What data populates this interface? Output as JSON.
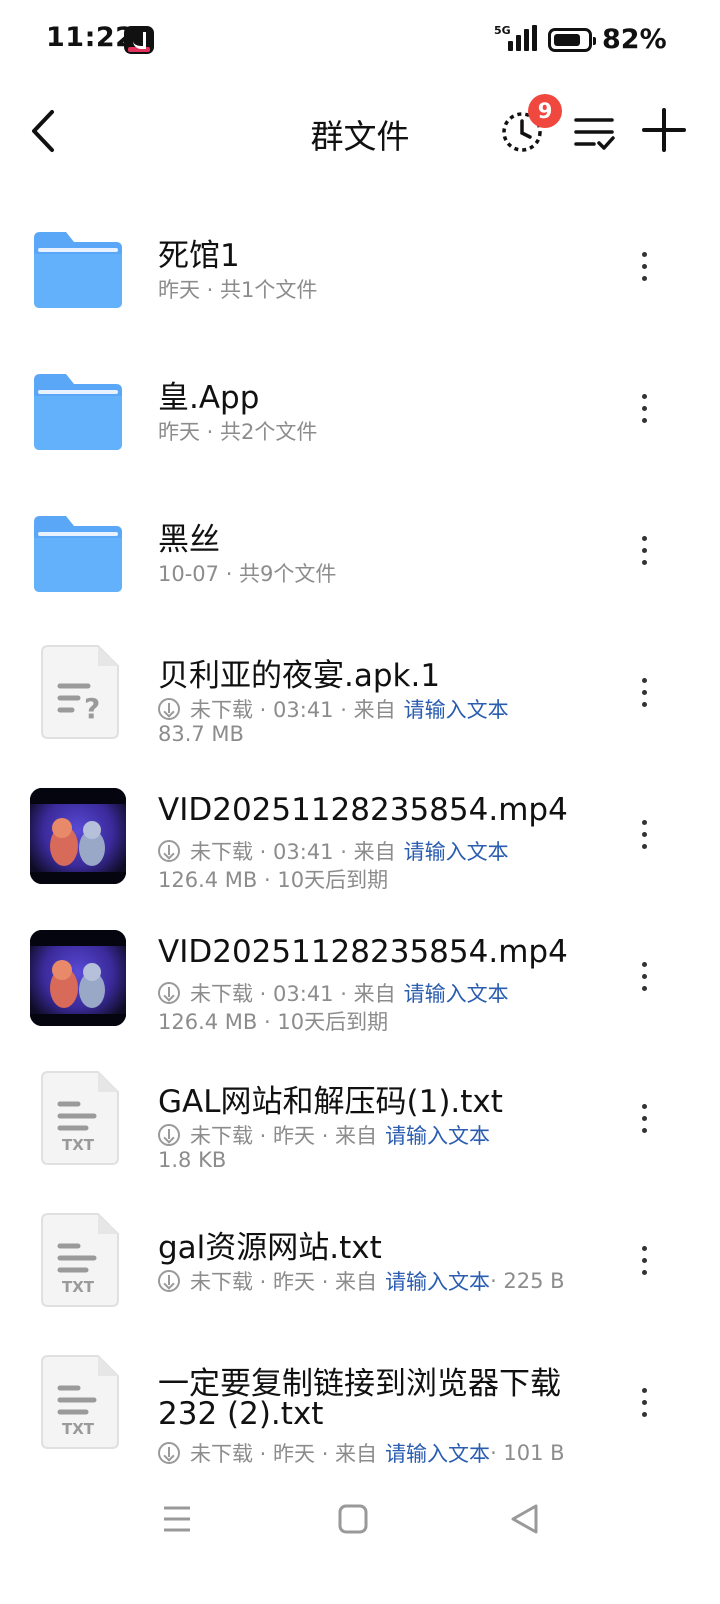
{
  "status_bar": {
    "time": "11:22",
    "battery_percent": "82%",
    "network": "5G",
    "battery_level": 0.82
  },
  "header": {
    "title": "群文件",
    "history_badge": "9"
  },
  "items": [
    {
      "type": "folder",
      "name": "死馆1",
      "sub": "昨天 · 共1个文件"
    },
    {
      "type": "folder",
      "name": "皇.App",
      "sub": "昨天 · 共2个文件"
    },
    {
      "type": "folder",
      "name": "黑丝",
      "sub": "10-07 · 共9个文件"
    },
    {
      "type": "file",
      "icon": "unknown-file-icon",
      "name": "贝利亚的夜宴.apk.1",
      "status": "未下载 · 03:41 · 来自",
      "uploader": "请输入文本",
      "meta": "83.7 MB",
      "meta_inline": ""
    },
    {
      "type": "video",
      "name": "VID20251128235854.mp4",
      "status": "未下载 · 03:41 · 来自",
      "uploader": "请输入文本",
      "meta": "126.4 MB · 10天后到期",
      "meta_inline": ""
    },
    {
      "type": "video",
      "name": "VID20251128235854.mp4",
      "status": "未下载 · 03:41 · 来自",
      "uploader": "请输入文本",
      "meta": "126.4 MB · 10天后到期",
      "meta_inline": ""
    },
    {
      "type": "txt",
      "name": "GAL网站和解压码(1).txt",
      "status": "未下载 · 昨天 · 来自",
      "uploader": "请输入文本",
      "meta": "1.8 KB",
      "meta_inline": ""
    },
    {
      "type": "txt",
      "name": "gal资源网站.txt",
      "status": "未下载 · 昨天 · 来自",
      "uploader": "请输入文本",
      "meta": "",
      "meta_inline": " · 225 B"
    },
    {
      "type": "txt",
      "name_line1": "一定要复制链接到浏览器下载",
      "name_line2": "232 (2).txt",
      "status": "未下载 · 昨天 · 来自",
      "uploader": "请输入文本",
      "meta": "",
      "meta_inline": " · 101 B"
    }
  ],
  "txt_label": "TXT",
  "colors": {
    "accent": "#2a5db0",
    "badge": "#f0483e",
    "folder": "#5aa7f8"
  }
}
